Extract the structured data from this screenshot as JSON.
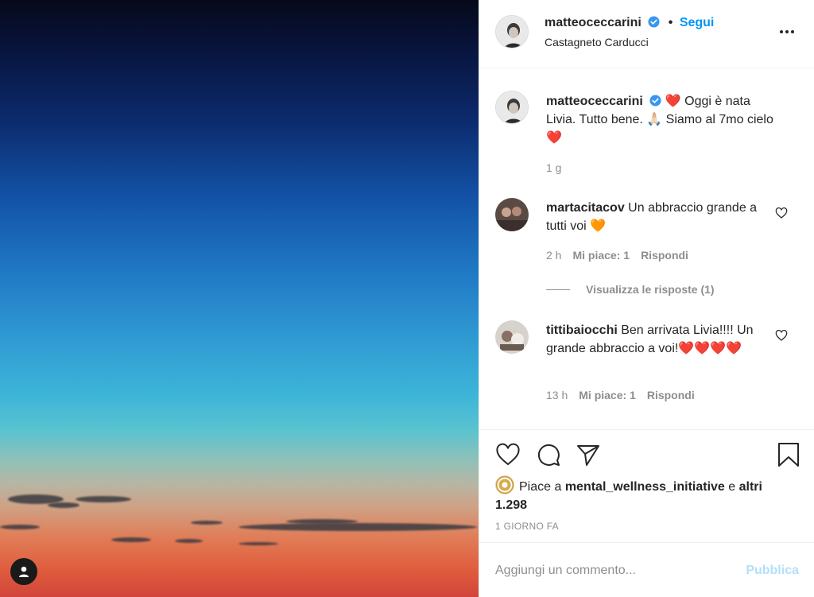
{
  "post": {
    "author": "matteoceccarini",
    "follow_label": "Segui",
    "location": "Castagneto Carducci",
    "caption_author": "matteoceccarini",
    "caption_text": "❤️ Oggi è nata Livia. Tutto bene. 🙏🏻 Siamo al 7mo cielo ❤️",
    "caption_time": "1 g"
  },
  "comments": [
    {
      "user": "martacitacov",
      "text": "Un abbraccio grande a tutti voi 🧡",
      "time": "2 h",
      "likes": "Mi piace: 1",
      "reply": "Rispondi",
      "view_replies": "Visualizza le risposte (1)"
    },
    {
      "user": "tittibaiocchi",
      "text": "Ben arrivata Livia!!!! Un grande abbraccio a voi!❤️❤️❤️❤️",
      "time": "13 h",
      "likes": "Mi piace: 1",
      "reply": "Rispondi"
    }
  ],
  "likes": {
    "prefix": "Piace a",
    "user": "mental_wellness_initiative",
    "conj": "e",
    "others": "altri 1.298"
  },
  "date_label": "1 GIORNO FA",
  "add_comment": {
    "placeholder": "Aggiungi un commento...",
    "publish_label": "Pubblica"
  },
  "icons": {
    "verified": "verified-badge-icon",
    "more": "more-options-icon",
    "like": "heart-icon",
    "comment": "comment-bubble-icon",
    "share": "paper-plane-icon",
    "save": "bookmark-icon",
    "user": "user-silhouette-icon"
  },
  "colors": {
    "accent": "#0095f6",
    "text": "#262626",
    "muted": "#8e8e8e",
    "publish_disabled": "#b2dffc"
  }
}
